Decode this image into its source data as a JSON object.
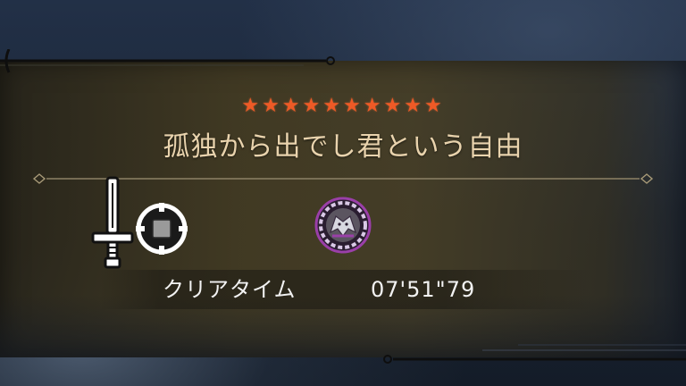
{
  "result": {
    "star_rating": 10,
    "star_glyph": "★",
    "quest_title": "孤独から出でし君という自由",
    "weapon_icon": "great-sword-icon",
    "target_icon": "crosshair-target-icon",
    "monster_icon": "monster-emblem-icon",
    "clear_time_label": "クリアタイム",
    "clear_time_value": "07'51\"79"
  },
  "colors": {
    "star": "#ee5a26",
    "title_text": "#e9d3ad",
    "panel": "#463e26",
    "value_text": "#f2f2f2",
    "monster_ring": "#9a3fa8"
  }
}
